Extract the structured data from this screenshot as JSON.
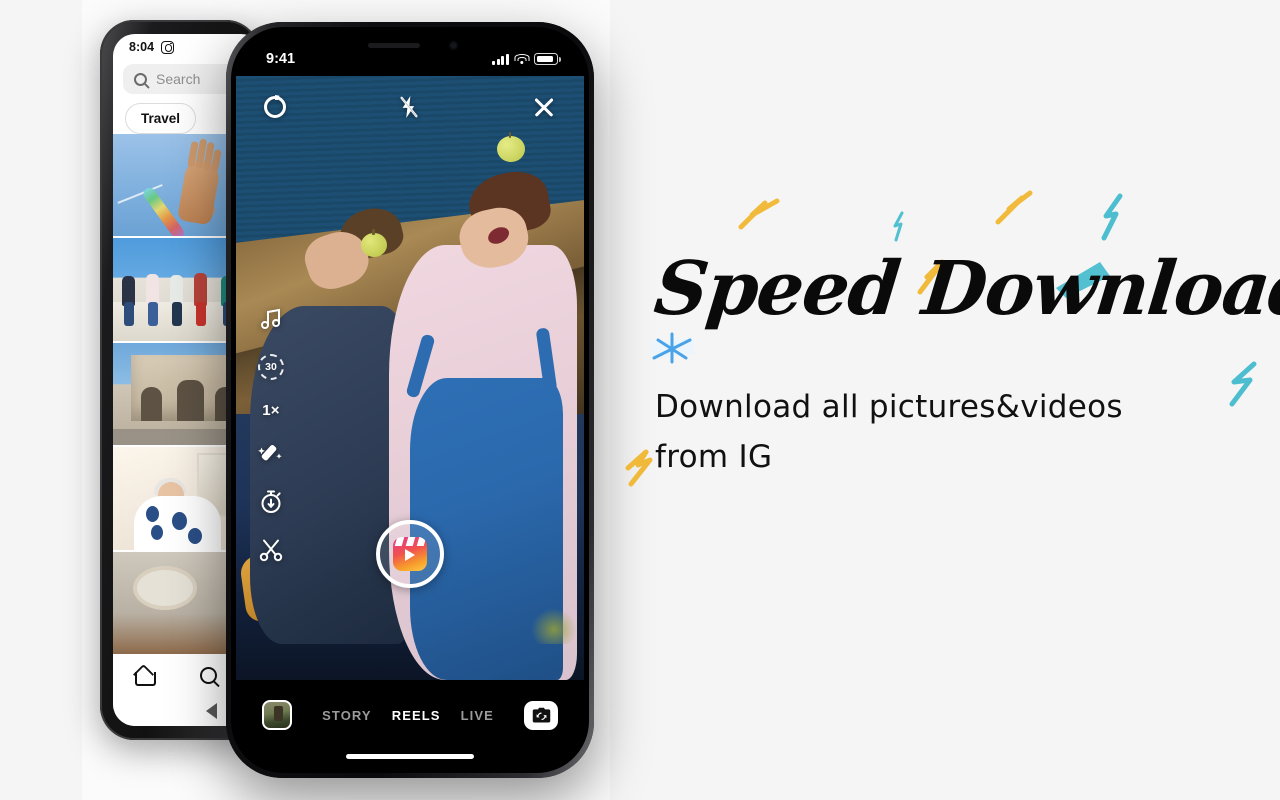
{
  "theme": {
    "page_bg": "#f5f5f5",
    "panel_mid_bg": "#fbfbfb",
    "accent_yellow": "#f0b429",
    "accent_teal": "#35b6c9",
    "accent_blue": "#4aa3e8",
    "text_dark": "#0a0a0a"
  },
  "marketing": {
    "headline": "Speed Download",
    "subtitle_line1": "Download all pictures&videos",
    "subtitle_line2": "from IG",
    "doodles": [
      {
        "name": "lightning-bolt-yellow-1",
        "color": "#f0b429"
      },
      {
        "name": "lightning-bolt-teal-1",
        "color": "#35b6c9"
      },
      {
        "name": "lightning-bolt-yellow-2",
        "color": "#f0b429"
      },
      {
        "name": "lightning-bolt-teal-2",
        "color": "#35b6c9"
      },
      {
        "name": "lightning-bolt-yellow-3",
        "color": "#f0b429"
      },
      {
        "name": "brush-swatch-teal",
        "color": "#35b6c9"
      },
      {
        "name": "sparkle-star-blue",
        "color": "#4aa3e8"
      },
      {
        "name": "lightning-bolt-yellow-4",
        "color": "#f0b429"
      },
      {
        "name": "lightning-bolt-teal-3",
        "color": "#35b6c9"
      }
    ]
  },
  "back_phone": {
    "status": {
      "time": "8:04",
      "app_icon": "instagram-icon"
    },
    "search": {
      "icon": "search-icon",
      "placeholder": "Search",
      "value": ""
    },
    "chips": [
      {
        "label": "Travel",
        "selected": true
      }
    ],
    "gallery": [
      {
        "name": "photo-rainbow-hand",
        "multi_select_icon": "carousel-icon"
      },
      {
        "name": "photo-friends-on-wall"
      },
      {
        "name": "photo-triumphal-arch"
      },
      {
        "name": "photo-woman-eating"
      },
      {
        "name": "photo-table-plate"
      }
    ],
    "nav": [
      {
        "name": "home-icon",
        "label": "Home"
      },
      {
        "name": "search-icon",
        "label": "Search"
      }
    ],
    "system_bar": {
      "back_icon": "back-triangle-icon"
    }
  },
  "front_phone": {
    "status": {
      "time": "9:41",
      "signal_icon": "cellular-signal-icon",
      "wifi_icon": "wifi-icon",
      "battery_icon": "battery-icon"
    },
    "camera_top": [
      {
        "name": "settings-gear-icon",
        "label": "Settings"
      },
      {
        "name": "flash-off-icon",
        "label": "Flash off"
      },
      {
        "name": "close-icon",
        "label": "Close"
      }
    ],
    "camera_tools": [
      {
        "name": "music-note-icon",
        "label": "Audio"
      },
      {
        "name": "duration-dial-icon",
        "label": "30"
      },
      {
        "name": "speed-label",
        "label": "1×"
      },
      {
        "name": "effects-wand-icon",
        "label": "Effects"
      },
      {
        "name": "timer-icon",
        "label": "Timer"
      },
      {
        "name": "trim-scissors-icon",
        "label": "Trim"
      }
    ],
    "shutter": {
      "name": "reels-shutter-button",
      "icon": "reels-clapper-icon"
    },
    "bottom": {
      "gallery_thumb": "gallery-thumbnail",
      "modes": [
        {
          "label": "STORY",
          "active": false
        },
        {
          "label": "REELS",
          "active": true
        },
        {
          "label": "LIVE",
          "active": false
        }
      ],
      "flip_icon": "camera-flip-icon"
    }
  }
}
